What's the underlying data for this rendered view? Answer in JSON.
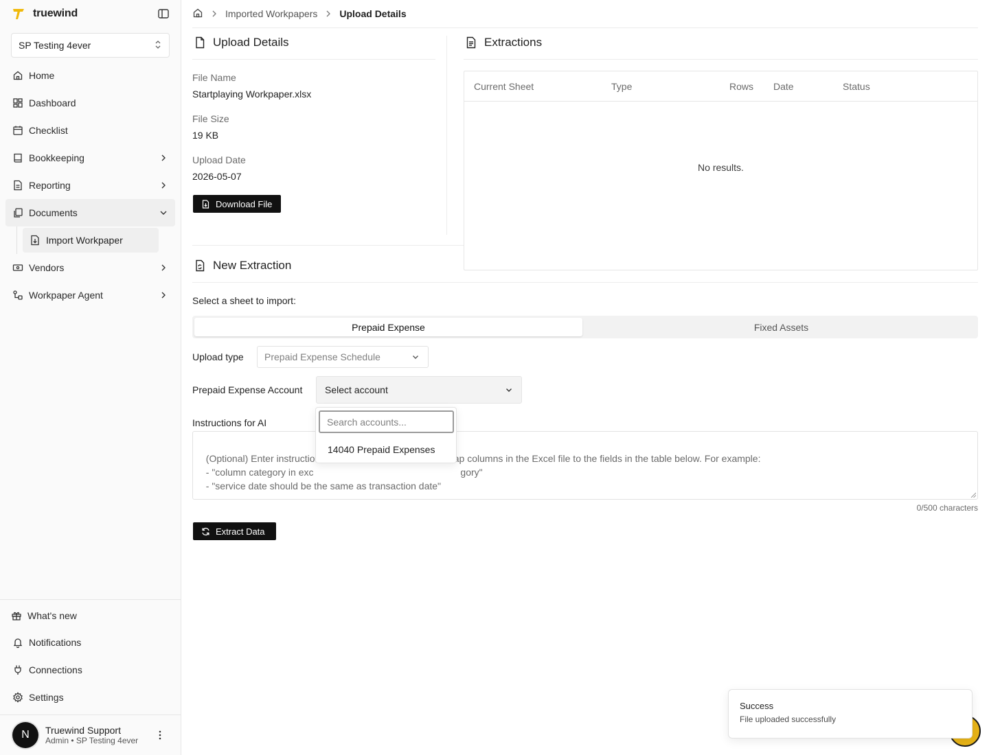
{
  "brand": {
    "name": "truewind",
    "accent": "#f0b90b"
  },
  "org_select": {
    "value": "SP Testing 4ever"
  },
  "nav": {
    "items": [
      {
        "label": "Home",
        "icon": "home-icon"
      },
      {
        "label": "Dashboard",
        "icon": "dashboard-icon"
      },
      {
        "label": "Checklist",
        "icon": "calendar-icon"
      },
      {
        "label": "Bookkeeping",
        "icon": "book-icon"
      },
      {
        "label": "Reporting",
        "icon": "report-icon"
      },
      {
        "label": "Documents",
        "icon": "documents-icon"
      },
      {
        "label": "Vendors",
        "icon": "vendor-icon"
      },
      {
        "label": "Workpaper Agent",
        "icon": "agent-icon"
      }
    ],
    "sub_item": {
      "label": "Import Workpaper",
      "icon": "file-import-icon"
    }
  },
  "sidebar_bottom": {
    "whats_new": "What's new",
    "notifications": "Notifications",
    "connections": "Connections",
    "settings": "Settings"
  },
  "user": {
    "initial": "N",
    "name": "Truewind Support",
    "role": "Admin • SP Testing 4ever"
  },
  "breadcrumb": {
    "parent": "Imported Workpapers",
    "current": "Upload Details"
  },
  "upload_details": {
    "title": "Upload Details",
    "file_name_label": "File Name",
    "file_name": "Startplaying Workpaper.xlsx",
    "file_size_label": "File Size",
    "file_size": "19 KB",
    "upload_date_label": "Upload Date",
    "upload_date": "2026-05-07",
    "download_button": "Download File"
  },
  "extractions": {
    "title": "Extractions",
    "columns": [
      "Current Sheet",
      "Type",
      "Rows",
      "Date",
      "Status"
    ],
    "empty_text": "No results."
  },
  "new_extraction": {
    "title": "New Extraction",
    "sheet_prompt": "Select a sheet to import:",
    "tabs": [
      "Prepaid Expense",
      "Fixed Assets"
    ],
    "upload_type_label": "Upload type",
    "upload_type_value": "Prepaid Expense Schedule",
    "account_label": "Prepaid Expense Account",
    "account_value": "Select account",
    "instructions_label": "Instructions for AI",
    "instructions_placeholder_visible": "(Optional) Enter instructio                                              o map columns in the Excel file to the fields in the table below. For example:\n  - \"column category in exc                                                       gory\"\n  - \"service date should be the same as transaction date\"",
    "char_count": "0/500 characters",
    "extract_button": "Extract Data"
  },
  "account_dropdown": {
    "search_placeholder": "Search accounts...",
    "options": [
      "14040 Prepaid Expenses"
    ]
  },
  "toast": {
    "title": "Success",
    "message": "File uploaded successfully"
  }
}
